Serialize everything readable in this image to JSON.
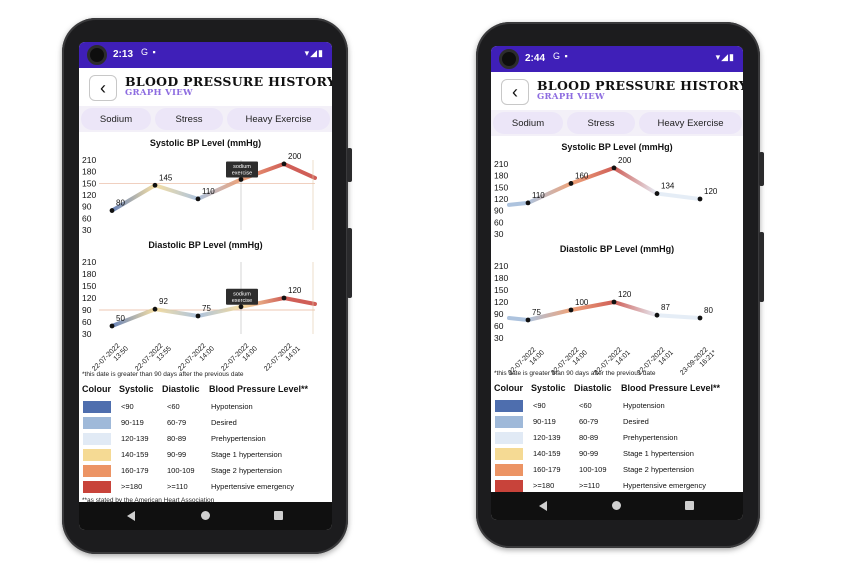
{
  "bp_ranges": {
    "headers": {
      "colour": "Colour",
      "systolic": "Systolic",
      "diastolic": "Diastolic",
      "level": "Blood Pressure Level**"
    },
    "rows": [
      {
        "color": "#4e6eae",
        "systolic": "<90",
        "diastolic": "<60",
        "level": "Hypotension"
      },
      {
        "color": "#9fb9d9",
        "systolic": "90-119",
        "diastolic": "60-79",
        "level": "Desired"
      },
      {
        "color": "#e1eaf5",
        "systolic": "120-139",
        "diastolic": "80-89",
        "level": "Prehypertension"
      },
      {
        "color": "#f5da94",
        "systolic": "140-159",
        "diastolic": "90-99",
        "level": "Stage 1 hypertension"
      },
      {
        "color": "#ec9464",
        "systolic": "160-179",
        "diastolic": "100-109",
        "level": "Stage 2 hypertension"
      },
      {
        "color": "#c8433a",
        "systolic": ">=180",
        "diastolic": ">=110",
        "level": "Hypertensive emergency"
      }
    ],
    "footnote": "**as stated by the American Heart Association",
    "date_note": "*this date is greater than 90 days after the previous date"
  },
  "phones": [
    {
      "status": {
        "time": "2:13",
        "icons": "G ▪",
        "right": "▾◢▮"
      },
      "header": {
        "title": "BLOOD PRESSURE HISTORY",
        "subtitle": "GRAPH VIEW",
        "back_icon": "‹"
      },
      "tabs": [
        "Sodium",
        "Stress",
        "Heavy Exercise"
      ],
      "systolic": {
        "title": "Systolic BP Level (mmHg)",
        "yticks": [
          "210",
          "180",
          "150",
          "120",
          "90",
          "60",
          "30"
        ],
        "point_labels": [
          "80",
          "145",
          "110",
          "",
          "200"
        ],
        "tooltip": [
          "sodium",
          "exercise"
        ]
      },
      "diastolic": {
        "title": "Diastolic BP Level (mmHg)",
        "yticks": [
          "210",
          "180",
          "150",
          "120",
          "90",
          "60",
          "30"
        ],
        "point_labels": [
          "50",
          "92",
          "75",
          "",
          "120"
        ],
        "tooltip": [
          "sodium",
          "exercise"
        ]
      },
      "dates": [
        [
          "22-07-2022",
          "13:50"
        ],
        [
          "22-07-2022",
          "13:55"
        ],
        [
          "22-07-2022",
          "14:00"
        ],
        [
          "22-07-2022",
          "14:00"
        ],
        [
          "22-07-2022",
          "14:01"
        ]
      ],
      "chart_data": [
        {
          "type": "line",
          "title": "Systolic BP Level (mmHg)",
          "xlabel": "",
          "ylabel": "",
          "ylim": [
            30,
            210
          ],
          "categories": [
            "22-07-2022 13:50",
            "22-07-2022 13:55",
            "22-07-2022 14:00",
            "22-07-2022 14:00",
            "22-07-2022 14:01"
          ],
          "values": [
            80,
            145,
            110,
            160,
            200
          ],
          "annotation": "sodium exercise",
          "reference_line": 150
        },
        {
          "type": "line",
          "title": "Diastolic BP Level (mmHg)",
          "xlabel": "",
          "ylabel": "",
          "ylim": [
            30,
            210
          ],
          "categories": [
            "22-07-2022 13:50",
            "22-07-2022 13:55",
            "22-07-2022 14:00",
            "22-07-2022 14:00",
            "22-07-2022 14:01"
          ],
          "values": [
            50,
            92,
            75,
            98,
            120
          ],
          "annotation": "sodium exercise",
          "reference_line": 90
        }
      ]
    },
    {
      "status": {
        "time": "2:44",
        "icons": "G ▪",
        "right": "▾◢▮"
      },
      "header": {
        "title": "BLOOD PRESSURE HISTORY",
        "subtitle": "GRAPH VIEW",
        "back_icon": "‹"
      },
      "tabs": [
        "Sodium",
        "Stress",
        "Heavy Exercise"
      ],
      "systolic": {
        "title": "Systolic BP Level (mmHg)",
        "yticks": [
          "210",
          "180",
          "150",
          "120",
          "90",
          "60",
          "30"
        ],
        "point_labels": [
          "110",
          "160",
          "200",
          "134",
          "120"
        ]
      },
      "diastolic": {
        "title": "Diastolic BP Level (mmHg)",
        "yticks": [
          "210",
          "180",
          "150",
          "120",
          "90",
          "60",
          "30"
        ],
        "point_labels": [
          "75",
          "100",
          "120",
          "87",
          "80"
        ]
      },
      "dates": [
        [
          "22-07-2022",
          "14:00"
        ],
        [
          "22-07-2022",
          "14:00"
        ],
        [
          "22-07-2022",
          "14:01"
        ],
        [
          "22-07-2022",
          "14:01"
        ],
        [
          "23-09-2022",
          "16:21*"
        ]
      ],
      "chart_data": [
        {
          "type": "line",
          "title": "Systolic BP Level (mmHg)",
          "xlabel": "",
          "ylabel": "",
          "ylim": [
            30,
            210
          ],
          "categories": [
            "22-07-2022 14:00",
            "22-07-2022 14:00",
            "22-07-2022 14:01",
            "22-07-2022 14:01",
            "23-09-2022 16:21*"
          ],
          "values": [
            110,
            160,
            200,
            134,
            120
          ]
        },
        {
          "type": "line",
          "title": "Diastolic BP Level (mmHg)",
          "xlabel": "",
          "ylabel": "",
          "ylim": [
            30,
            210
          ],
          "categories": [
            "22-07-2022 14:00",
            "22-07-2022 14:00",
            "22-07-2022 14:01",
            "22-07-2022 14:01",
            "23-09-2022 16:21*"
          ],
          "values": [
            75,
            100,
            120,
            87,
            80
          ]
        }
      ]
    }
  ]
}
